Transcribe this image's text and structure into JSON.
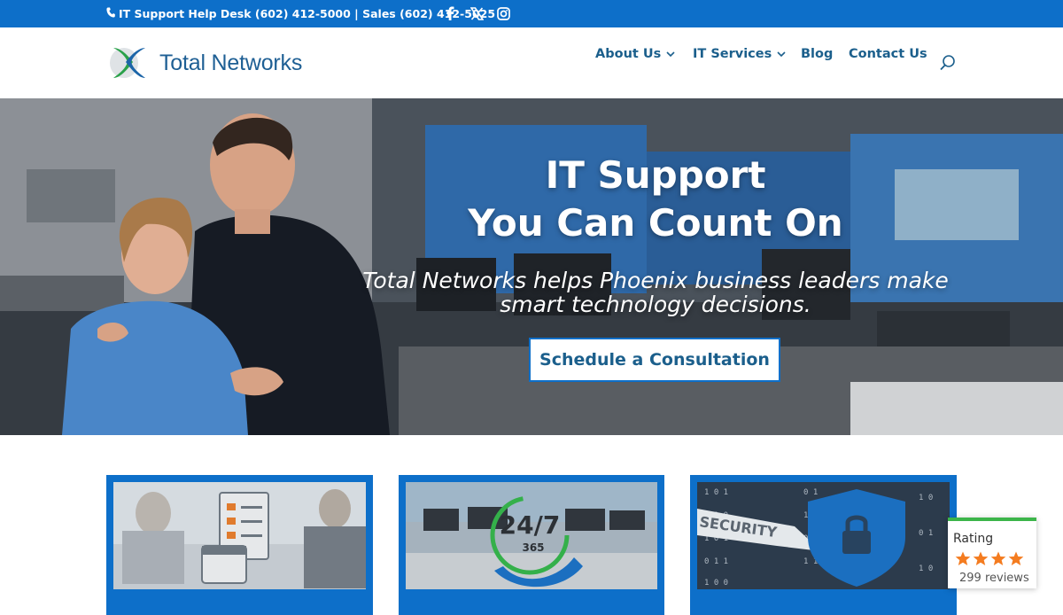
{
  "topbar": {
    "contact_text": "IT Support Help Desk (602) 412-5000 | Sales (602) 412-5025",
    "social": [
      "facebook-icon",
      "x-icon",
      "instagram-icon"
    ],
    "bg_color": "#0d6fc9"
  },
  "header": {
    "logo_text": "Total Networks",
    "nav": [
      {
        "label": "About Us",
        "has_dropdown": true
      },
      {
        "label": "IT Services",
        "has_dropdown": true
      },
      {
        "label": "Blog",
        "has_dropdown": false
      },
      {
        "label": "Contact Us",
        "has_dropdown": false
      }
    ]
  },
  "hero": {
    "title_line1": "IT Support",
    "title_line2": "You Can Count On",
    "subtitle": "Total Networks helps Phoenix business leaders make smart technology decisions.",
    "cta_label": "Schedule a Consultation"
  },
  "cards": [
    {
      "name": "planning-card",
      "image_text": ""
    },
    {
      "name": "support-247-card",
      "image_text": "24/7 365"
    },
    {
      "name": "security-card",
      "image_text": "SECURITY"
    }
  ],
  "rating_widget": {
    "label": "Rating",
    "stars": 4,
    "count_text": "299 reviews"
  },
  "colors": {
    "brand_blue": "#0d6fc9",
    "nav_text": "#1b5f8c",
    "star": "#f47c20",
    "rating_accent": "#3cb54a"
  }
}
